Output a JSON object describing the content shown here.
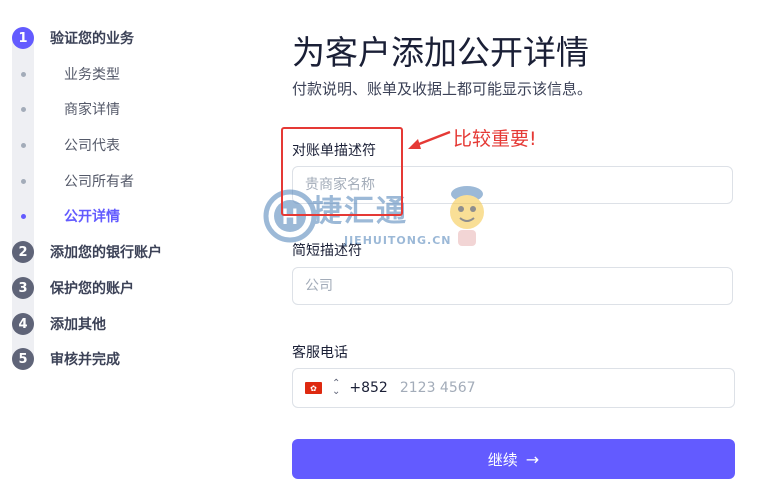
{
  "sidebar": {
    "steps": [
      {
        "num": "1",
        "label": "验证您的业务",
        "active": true
      },
      {
        "num": "2",
        "label": "添加您的银行账户"
      },
      {
        "num": "3",
        "label": "保护您的账户"
      },
      {
        "num": "4",
        "label": "添加其他"
      },
      {
        "num": "5",
        "label": "审核并完成"
      }
    ],
    "substeps": [
      {
        "label": "业务类型"
      },
      {
        "label": "商家详情"
      },
      {
        "label": "公司代表"
      },
      {
        "label": "公司所有者"
      },
      {
        "label": "公开详情",
        "active": true
      }
    ]
  },
  "main": {
    "title": "为客户添加公开详情",
    "subtitle": "付款说明、账单及收据上都可能显示该信息。",
    "statement_descriptor": {
      "label": "对账单描述符",
      "placeholder": "贵商家名称",
      "value": ""
    },
    "short_descriptor": {
      "label": "简短描述符",
      "placeholder": "公司",
      "value": ""
    },
    "support_phone": {
      "label": "客服电话",
      "country_code": "+852",
      "placeholder": "2123 4567",
      "flag_icon": "hong-kong-flag-icon"
    },
    "continue_button": {
      "label": "继续",
      "icon": "arrow-right-icon"
    }
  },
  "annotation": {
    "note": "比较重要!",
    "color": "#e53935"
  },
  "watermark": {
    "text": "捷汇通",
    "subtext": "JIEHUITONG.CN",
    "letter": "H"
  },
  "colors": {
    "accent": "#635bff",
    "step_inactive": "#5f6478"
  }
}
